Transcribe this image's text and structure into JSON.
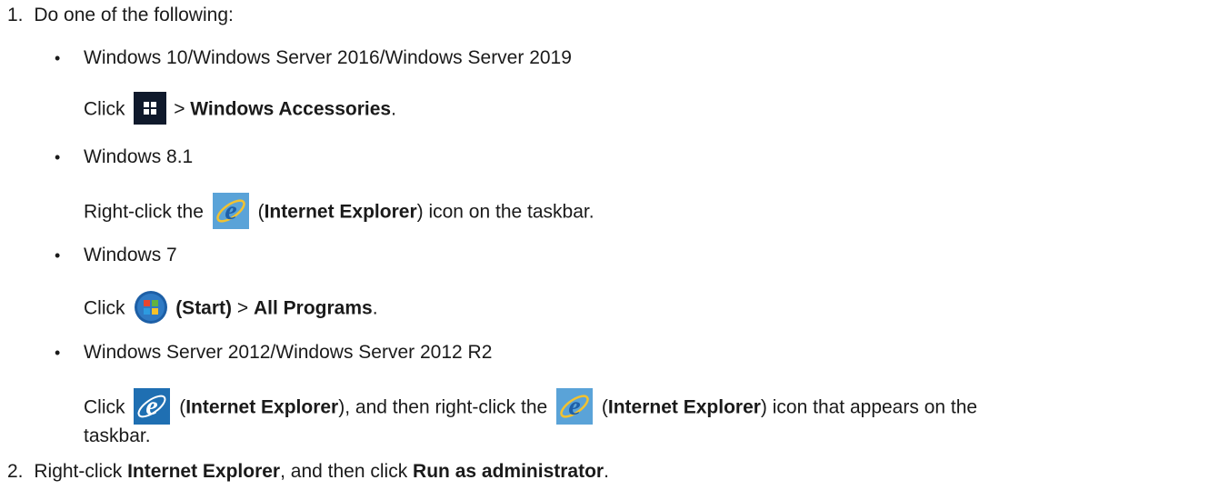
{
  "step1": {
    "number": "1.",
    "intro": "Do one of the following:"
  },
  "bullet_char": "•",
  "items": [
    {
      "heading": "Windows 10/Windows Server 2016/Windows Server 2019",
      "click": "Click",
      "gt": ">",
      "target": "Windows Accessories",
      "end": "."
    },
    {
      "heading": "Windows 8.1",
      "rightclick": "Right-click the",
      "open": "(",
      "target": "Internet Explorer",
      "rest": ") icon on the taskbar."
    },
    {
      "heading": "Windows 7",
      "click": "Click",
      "start": "(Start)",
      "gt": ">",
      "target": "All Programs",
      "end": "."
    },
    {
      "heading": "Windows Server 2012/Windows Server 2012 R2",
      "click": "Click",
      "open1": "(",
      "target1": "Internet Explorer",
      "mid": "), and then right-click the",
      "open2": "(",
      "target2": "Internet Explorer",
      "rest": ") icon that appears on the",
      "wrap": "taskbar."
    }
  ],
  "step2": {
    "number": "2.",
    "pre": "Right-click",
    "target1": "Internet Explorer",
    "mid": ", and then click",
    "target2": "Run as administrator",
    "end": "."
  },
  "icons": {
    "windows_start": "windows-logo-icon",
    "internet_explorer": "internet-explorer-icon",
    "windows7_start": "windows7-start-orb-icon"
  }
}
